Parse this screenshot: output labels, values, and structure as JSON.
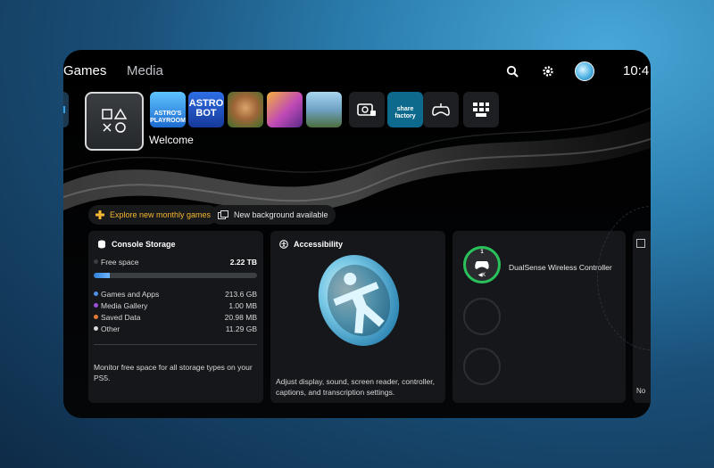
{
  "nav": {
    "tabs": [
      {
        "label": "Games"
      },
      {
        "label": "Media"
      }
    ],
    "clock": "10:4",
    "icons": [
      "search-icon",
      "gear-icon",
      "avatar"
    ]
  },
  "tiles": {
    "welcome_label": "Welcome",
    "playroom_text": "ASTRO'S\nPLAYROOM",
    "astrobot_text": "ASTRO BOT",
    "sharefactory_text": "share factory",
    "items": [
      "welcome-hub",
      "astros-playroom",
      "astro-bot",
      "sackboy",
      "ratchet-and-clank",
      "horizon",
      "share-screen",
      "sharefactory",
      "remote-play",
      "game-library"
    ]
  },
  "pills": {
    "explore": "Explore new monthly games",
    "background": "New background available"
  },
  "storage": {
    "title": "Console Storage",
    "free_label": "Free space",
    "free_value": "2.22 TB",
    "used_fraction": 0.1,
    "legend": [
      {
        "label": "Games and Apps",
        "value": "213.6 GB",
        "color": "#4f8fe8"
      },
      {
        "label": "Media Gallery",
        "value": "1.00 MB",
        "color": "#9b4fd6"
      },
      {
        "label": "Saved Data",
        "value": "20.98 MB",
        "color": "#e27a33"
      },
      {
        "label": "Other",
        "value": "11.29 GB",
        "color": "#d9d9d9"
      }
    ],
    "note": "Monitor free space for all storage types on your PS5."
  },
  "accessibility": {
    "title": "Accessibility",
    "description": "Adjust display, sound, screen reader, controller, captions, and transcription settings."
  },
  "controllers": {
    "active_number": "1",
    "active_sub": "◀K",
    "active_name": "DualSense Wireless Controller",
    "status_color": "#29c25a"
  },
  "next_card": {
    "text": "No"
  }
}
